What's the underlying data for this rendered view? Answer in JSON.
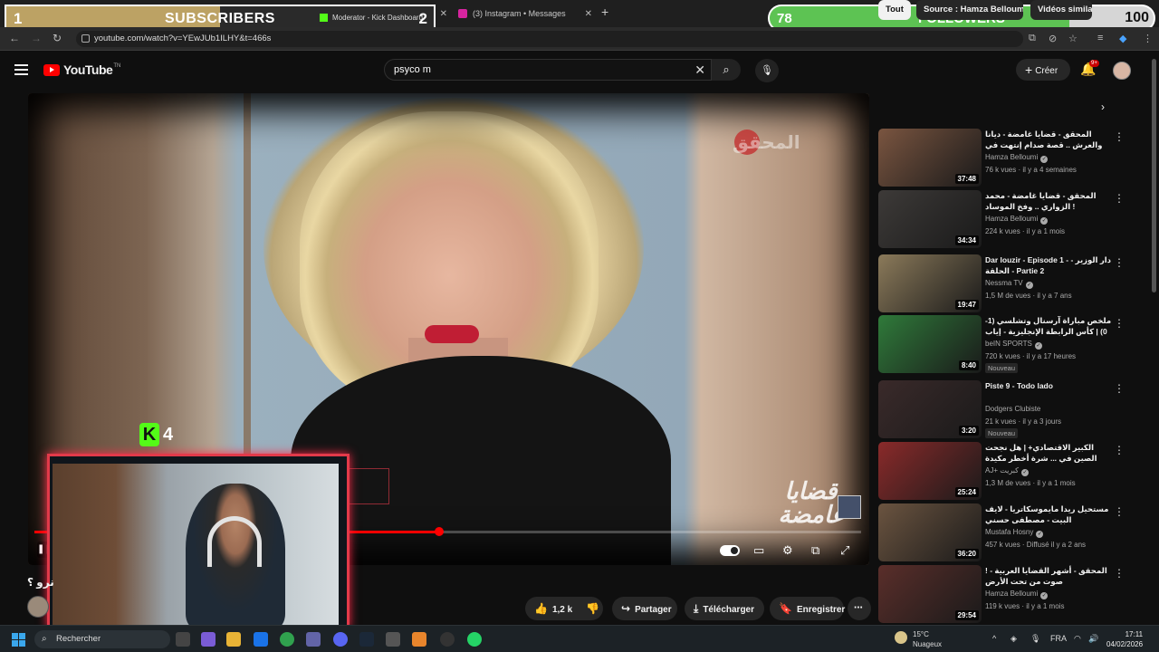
{
  "browser": {
    "tabs": [
      {
        "title": "Moderator - Kick Dashboard",
        "favicon_color": "#53fc18"
      },
      {
        "title": "(3) Instagram • Messages",
        "favicon_color": "#d6249f"
      }
    ],
    "url": "youtube.com/watch?v=YEwJUb1ILHY&t=466s"
  },
  "stream_overlays": {
    "subscribers": {
      "left_num": "1",
      "label": "SUBSCRIBERS",
      "right_num": "2"
    },
    "followers": {
      "left_num": "78",
      "label": "FOLLOWERS",
      "right_num": "100",
      "progress_fraction": 0.78
    }
  },
  "youtube": {
    "logo_text": "YouTube",
    "logo_tn": "TN",
    "search_query": "psyco m",
    "create_label": "Créer",
    "notif_badge": "9+",
    "video": {
      "channel_watermark": "المحقق",
      "show_watermark": "قضايا غامضة",
      "kick_logo_k": "K",
      "kick_logo_num": "4",
      "progress_fraction": 0.49,
      "title_fragment": "نرو ؟"
    },
    "actions": {
      "likes": "1,2 k",
      "share": "Partager",
      "download": "Télécharger",
      "save": "Enregistrer"
    },
    "chips": [
      "Tout",
      "Source : Hamza Belloumi",
      "Vidéos similaires"
    ],
    "recommendations": [
      {
        "title": "المحقق - قضايا غامضة - ديانا والعرش .. قصة صدام إنتهت في نفق",
        "channel": "Hamza Belloumi",
        "verified": true,
        "meta": "76 k vues · il y a 4 semaines",
        "duration": "37:48",
        "badge": "",
        "thumb_color": "#7a5540"
      },
      {
        "title": "المحقق - قضايا غامضة - محمد الزواري .. وفخ الموساد !",
        "channel": "Hamza Belloumi",
        "verified": true,
        "meta": "224 k vues · il y a 1 mois",
        "duration": "34:34",
        "badge": "",
        "thumb_color": "#3d3a38"
      },
      {
        "title": "Dar louzir - Episode 1 - دار الوزير - الحلقة - Partie 2",
        "channel": "Nessma TV",
        "verified": true,
        "meta": "1,5 M de vues · il y a 7 ans",
        "duration": "19:47",
        "badge": "",
        "thumb_color": "#8b7a5a"
      },
      {
        "title": "ملخص مباراة آرسنال وتشلسي (1-0) | كأس الرابطة الإنجليزية - إياب نصف النهائي",
        "channel": "beIN SPORTS",
        "verified": true,
        "meta": "720 k vues · il y a 17 heures",
        "duration": "8:40",
        "badge": "Nouveau",
        "thumb_color": "#2f7a3a"
      },
      {
        "title": "Piste 9 - Todo lado",
        "channel": "Dodgers Clubiste",
        "verified": false,
        "meta": "21 k vues · il y a 3 jours",
        "duration": "3:20",
        "badge": "Nouveau",
        "thumb_color": "#3a2a2a"
      },
      {
        "title": "الكبير الاقتصادي+ | هل نجحت الصين في ... شرة أخطر مكيدة في العالم وكسر حصار",
        "channel": "AJ+ كبريت",
        "verified": true,
        "meta": "1,3 M de vues · il y a 1 mois",
        "duration": "25:24",
        "badge": "",
        "thumb_color": "#8a2a2a"
      },
      {
        "title": "مستحيل ريدا مايموسكاتريا - لايف البيت - مصطفى حسني",
        "channel": "Mustafa Hosny",
        "verified": true,
        "meta": "457 k vues · Diffusé il y a 2 ans",
        "duration": "36:20",
        "badge": "",
        "thumb_color": "#6b5440"
      },
      {
        "title": "! المحقق - أشهر القضايا العربية - صوت من تحت الأرض",
        "channel": "Hamza Belloumi",
        "verified": true,
        "meta": "119 k vues · il y a 1 mois",
        "duration": "29:54",
        "badge": "",
        "thumb_color": "#5a2e2a"
      }
    ]
  },
  "taskbar": {
    "search_label": "Rechercher",
    "weather_temp": "15°C",
    "weather_desc": "Nuageux",
    "lang": "FRA",
    "time": "17:11",
    "date": "04/02/2026"
  }
}
